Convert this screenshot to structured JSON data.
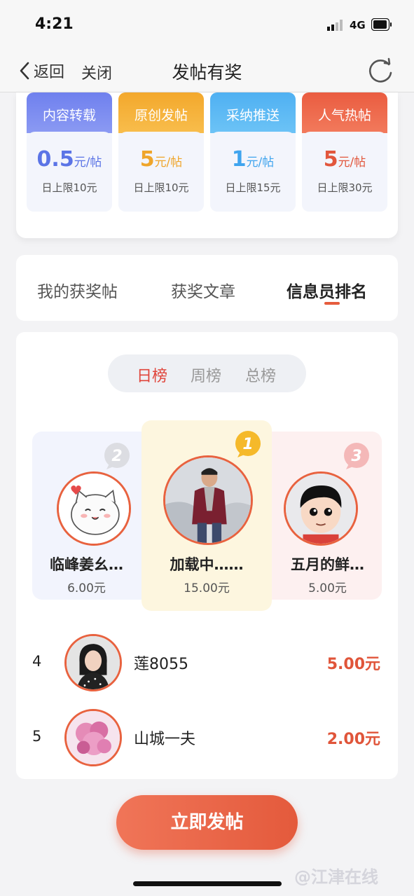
{
  "status": {
    "time": "4:21",
    "network": "4G"
  },
  "nav": {
    "back_label": "返回",
    "close_label": "关闭",
    "title": "发帖有奖"
  },
  "rewards": [
    {
      "title": "内容转载",
      "value": "0.5",
      "unit": "元/帖",
      "limit": "日上限10元",
      "color": "#5b74e6",
      "head_color": "#7b8cf0"
    },
    {
      "title": "原创发帖",
      "value": "5",
      "unit": "元/帖",
      "limit": "日上限10元",
      "color": "#efa52a",
      "head_color": "#f6b33c"
    },
    {
      "title": "采纳推送",
      "value": "1",
      "unit": "元/帖",
      "limit": "日上限15元",
      "color": "#3fa4ee",
      "head_color": "#5ab8f4"
    },
    {
      "title": "人气热帖",
      "value": "5",
      "unit": "元/帖",
      "limit": "日上限30元",
      "color": "#e2563c",
      "head_color": "#ee6a4c"
    }
  ],
  "tabs": [
    "我的获奖帖",
    "获奖文章",
    "信息员排名"
  ],
  "segments": [
    "日榜",
    "周榜",
    "总榜"
  ],
  "podium": [
    {
      "rank": "2",
      "name": "临峰姜幺…",
      "amount": "6.00元"
    },
    {
      "rank": "1",
      "name": "加载中……",
      "amount": "15.00元"
    },
    {
      "rank": "3",
      "name": "五月的鲜…",
      "amount": "5.00元"
    }
  ],
  "list": [
    {
      "rank": "4",
      "name": "莲8055",
      "amount": "5.00元"
    },
    {
      "rank": "5",
      "name": "山城一夫",
      "amount": "2.00元"
    }
  ],
  "cta_label": "立即发帖",
  "watermark": "@江津在线",
  "colors": {
    "accent": "#e45a3c",
    "active_segment": "#e0443a"
  }
}
